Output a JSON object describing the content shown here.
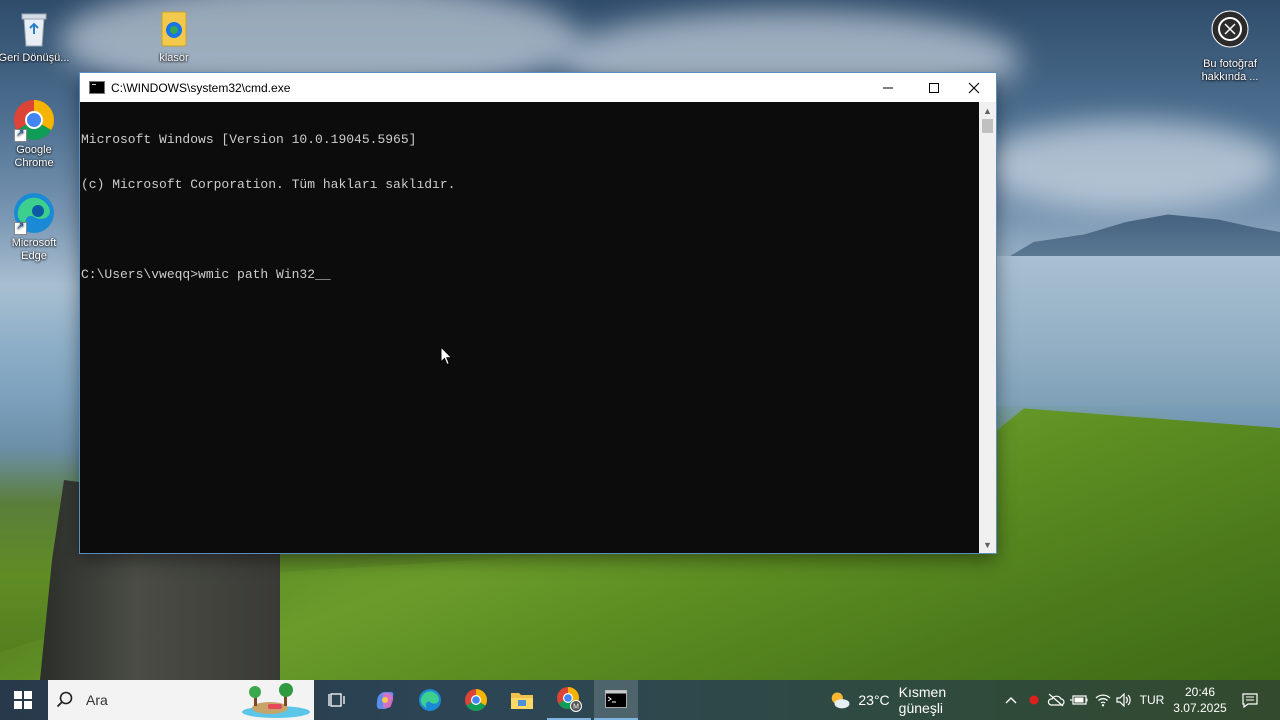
{
  "desktop": {
    "icons": [
      {
        "label": "Geri Dönüşü..."
      },
      {
        "label": "klasör"
      },
      {
        "label": "Google Chrome"
      },
      {
        "label": "Microsoft Edge"
      },
      {
        "label": "Bu fotoğraf hakkında ..."
      }
    ]
  },
  "cmd_window": {
    "title": "C:\\WINDOWS\\system32\\cmd.exe",
    "lines": [
      "Microsoft Windows [Version 10.0.19045.5965]",
      "(c) Microsoft Corporation. Tüm hakları saklıdır.",
      "",
      "C:\\Users\\vweqq>wmic path Win32_"
    ]
  },
  "taskbar": {
    "search_placeholder": "Ara",
    "weather": {
      "temperature": "23°C",
      "condition": "Kısmen güneşli"
    },
    "language": "TUR",
    "time": "20:46",
    "date": "3.07.2025"
  },
  "colors": {
    "console_bg": "#0c0c0c",
    "console_text": "#cccccc",
    "accent": "#5a8ec0"
  }
}
